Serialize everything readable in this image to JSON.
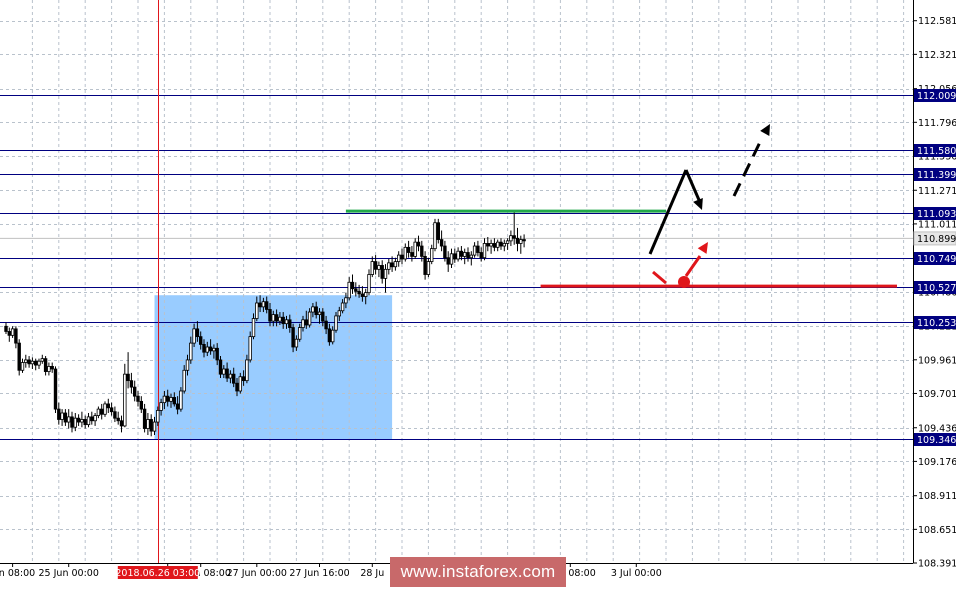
{
  "colors": {
    "background": "#ffffff",
    "grid": "#b9c2cc",
    "level_line": "#000080",
    "level_label_bg": "#000080",
    "level_label_text": "#ffffff",
    "current_price_bg": "#e6e6e6",
    "candle": "#000000",
    "zone": "#99ccff",
    "green_line": "#22a84a",
    "red_line": "#e0161b",
    "vertical_marker": "#e0161b",
    "date_marker_bg": "#e0161b"
  },
  "chart_data": {
    "type": "candlestick",
    "instrument": "USD/JPY",
    "ylim": [
      108.391,
      112.741
    ],
    "y_ticks": [
      "112.581",
      "112.321",
      "112.056",
      "111.796",
      "111.536",
      "111.271",
      "111.011",
      "110.751",
      "110.486",
      "110.221",
      "109.961",
      "109.701",
      "109.436",
      "109.176",
      "108.911",
      "108.651",
      "108.391"
    ],
    "x_ticks": [
      {
        "label": "Jun 08:00",
        "bar": 2
      },
      {
        "label": "25 Jun 00:00",
        "bar": 19
      },
      {
        "label": "26 Jun 16:00",
        "bar": 49
      },
      {
        "label": "27 Jun 08:00",
        "bar": 59
      },
      {
        "label": "27 Jun 00:00",
        "bar": 76
      },
      {
        "label": "27 Jun 16:00",
        "bar": 95
      },
      {
        "label": "28 Ju",
        "bar": 111
      },
      {
        "label": "2 Jul 08:00",
        "bar": 171
      },
      {
        "label": "3 Jul 00:00",
        "bar": 191
      }
    ],
    "time_marker": {
      "label": "2018.06.26 03:00",
      "bar": 46
    },
    "current_price": "110.899",
    "levels": [
      {
        "label": "112.009",
        "value": 112.009
      },
      {
        "label": "111.580",
        "value": 111.58
      },
      {
        "label": "111.399",
        "value": 111.399
      },
      {
        "label": "111.093",
        "value": 111.093
      },
      {
        "label": "110.749",
        "value": 110.749
      },
      {
        "label": "110.527",
        "value": 110.527
      },
      {
        "label": "110.253",
        "value": 110.253
      },
      {
        "label": "109.346",
        "value": 109.346
      }
    ],
    "zone": {
      "bar_from": 45,
      "bar_to": 117,
      "price_low": 109.346,
      "price_high": 110.46
    },
    "green_line": {
      "bar_from": 103,
      "bar_to": 200,
      "price": 111.11
    },
    "red_line": {
      "bar_from": 162,
      "bar_to": 270,
      "price": 110.53
    },
    "candles": [
      {
        "o": 110.22,
        "h": 110.25,
        "l": 110.16,
        "c": 110.18
      },
      {
        "o": 110.18,
        "h": 110.21,
        "l": 110.1,
        "c": 110.15
      },
      {
        "o": 110.15,
        "h": 110.22,
        "l": 110.13,
        "c": 110.2
      },
      {
        "o": 110.2,
        "h": 110.22,
        "l": 110.05,
        "c": 110.09
      },
      {
        "o": 110.09,
        "h": 110.12,
        "l": 109.84,
        "c": 109.88
      },
      {
        "o": 109.88,
        "h": 109.97,
        "l": 109.86,
        "c": 109.94
      },
      {
        "o": 109.94,
        "h": 110.0,
        "l": 109.9,
        "c": 109.96
      },
      {
        "o": 109.96,
        "h": 109.99,
        "l": 109.9,
        "c": 109.93
      },
      {
        "o": 109.93,
        "h": 109.98,
        "l": 109.89,
        "c": 109.95
      },
      {
        "o": 109.95,
        "h": 109.97,
        "l": 109.88,
        "c": 109.92
      },
      {
        "o": 109.92,
        "h": 109.97,
        "l": 109.89,
        "c": 109.95
      },
      {
        "o": 109.95,
        "h": 110.0,
        "l": 109.93,
        "c": 109.97
      },
      {
        "o": 109.97,
        "h": 109.99,
        "l": 109.84,
        "c": 109.87
      },
      {
        "o": 109.87,
        "h": 109.94,
        "l": 109.84,
        "c": 109.91
      },
      {
        "o": 109.91,
        "h": 109.94,
        "l": 109.86,
        "c": 109.89
      },
      {
        "o": 109.89,
        "h": 109.91,
        "l": 109.55,
        "c": 109.58
      },
      {
        "o": 109.58,
        "h": 109.63,
        "l": 109.46,
        "c": 109.5
      },
      {
        "o": 109.5,
        "h": 109.58,
        "l": 109.45,
        "c": 109.55
      },
      {
        "o": 109.55,
        "h": 109.58,
        "l": 109.45,
        "c": 109.48
      },
      {
        "o": 109.48,
        "h": 109.58,
        "l": 109.43,
        "c": 109.52
      },
      {
        "o": 109.52,
        "h": 109.56,
        "l": 109.4,
        "c": 109.44
      },
      {
        "o": 109.44,
        "h": 109.55,
        "l": 109.41,
        "c": 109.51
      },
      {
        "o": 109.51,
        "h": 109.54,
        "l": 109.45,
        "c": 109.48
      },
      {
        "o": 109.48,
        "h": 109.56,
        "l": 109.44,
        "c": 109.5
      },
      {
        "o": 109.5,
        "h": 109.53,
        "l": 109.43,
        "c": 109.46
      },
      {
        "o": 109.46,
        "h": 109.55,
        "l": 109.44,
        "c": 109.52
      },
      {
        "o": 109.52,
        "h": 109.56,
        "l": 109.46,
        "c": 109.49
      },
      {
        "o": 109.49,
        "h": 109.55,
        "l": 109.45,
        "c": 109.53
      },
      {
        "o": 109.53,
        "h": 109.6,
        "l": 109.51,
        "c": 109.58
      },
      {
        "o": 109.58,
        "h": 109.62,
        "l": 109.5,
        "c": 109.54
      },
      {
        "o": 109.54,
        "h": 109.64,
        "l": 109.52,
        "c": 109.62
      },
      {
        "o": 109.62,
        "h": 109.66,
        "l": 109.55,
        "c": 109.59
      },
      {
        "o": 109.59,
        "h": 109.63,
        "l": 109.53,
        "c": 109.56
      },
      {
        "o": 109.56,
        "h": 109.6,
        "l": 109.48,
        "c": 109.51
      },
      {
        "o": 109.51,
        "h": 109.56,
        "l": 109.46,
        "c": 109.49
      },
      {
        "o": 109.49,
        "h": 109.53,
        "l": 109.4,
        "c": 109.45
      },
      {
        "o": 109.45,
        "h": 109.93,
        "l": 109.44,
        "c": 109.85
      },
      {
        "o": 109.85,
        "h": 110.02,
        "l": 109.74,
        "c": 109.8
      },
      {
        "o": 109.8,
        "h": 109.86,
        "l": 109.7,
        "c": 109.75
      },
      {
        "o": 109.75,
        "h": 109.8,
        "l": 109.64,
        "c": 109.68
      },
      {
        "o": 109.68,
        "h": 109.72,
        "l": 109.6,
        "c": 109.64
      },
      {
        "o": 109.64,
        "h": 109.68,
        "l": 109.55,
        "c": 109.58
      },
      {
        "o": 109.58,
        "h": 109.62,
        "l": 109.4,
        "c": 109.43
      },
      {
        "o": 109.43,
        "h": 109.55,
        "l": 109.38,
        "c": 109.5
      },
      {
        "o": 109.5,
        "h": 109.54,
        "l": 109.37,
        "c": 109.41
      },
      {
        "o": 109.41,
        "h": 109.52,
        "l": 109.38,
        "c": 109.48
      },
      {
        "o": 109.48,
        "h": 109.6,
        "l": 109.45,
        "c": 109.57
      },
      {
        "o": 109.57,
        "h": 109.66,
        "l": 109.53,
        "c": 109.63
      },
      {
        "o": 109.63,
        "h": 109.72,
        "l": 109.58,
        "c": 109.68
      },
      {
        "o": 109.68,
        "h": 109.73,
        "l": 109.6,
        "c": 109.64
      },
      {
        "o": 109.64,
        "h": 109.7,
        "l": 109.59,
        "c": 109.67
      },
      {
        "o": 109.67,
        "h": 109.71,
        "l": 109.6,
        "c": 109.62
      },
      {
        "o": 109.62,
        "h": 109.68,
        "l": 109.54,
        "c": 109.58
      },
      {
        "o": 109.58,
        "h": 109.75,
        "l": 109.56,
        "c": 109.72
      },
      {
        "o": 109.72,
        "h": 109.92,
        "l": 109.7,
        "c": 109.88
      },
      {
        "o": 109.88,
        "h": 110.0,
        "l": 109.84,
        "c": 109.96
      },
      {
        "o": 109.96,
        "h": 110.14,
        "l": 109.93,
        "c": 110.09
      },
      {
        "o": 110.09,
        "h": 110.24,
        "l": 110.06,
        "c": 110.2
      },
      {
        "o": 110.2,
        "h": 110.26,
        "l": 110.1,
        "c": 110.14
      },
      {
        "o": 110.14,
        "h": 110.18,
        "l": 110.04,
        "c": 110.08
      },
      {
        "o": 110.08,
        "h": 110.12,
        "l": 109.98,
        "c": 110.02
      },
      {
        "o": 110.02,
        "h": 110.1,
        "l": 109.99,
        "c": 110.06
      },
      {
        "o": 110.06,
        "h": 110.12,
        "l": 110.0,
        "c": 110.03
      },
      {
        "o": 110.03,
        "h": 110.08,
        "l": 109.97,
        "c": 110.05
      },
      {
        "o": 110.05,
        "h": 110.09,
        "l": 109.92,
        "c": 109.96
      },
      {
        "o": 109.96,
        "h": 109.99,
        "l": 109.82,
        "c": 109.85
      },
      {
        "o": 109.85,
        "h": 109.92,
        "l": 109.82,
        "c": 109.89
      },
      {
        "o": 109.89,
        "h": 109.94,
        "l": 109.79,
        "c": 109.82
      },
      {
        "o": 109.82,
        "h": 109.88,
        "l": 109.78,
        "c": 109.85
      },
      {
        "o": 109.85,
        "h": 109.9,
        "l": 109.75,
        "c": 109.78
      },
      {
        "o": 109.78,
        "h": 109.82,
        "l": 109.68,
        "c": 109.72
      },
      {
        "o": 109.72,
        "h": 109.86,
        "l": 109.7,
        "c": 109.83
      },
      {
        "o": 109.83,
        "h": 109.88,
        "l": 109.76,
        "c": 109.8
      },
      {
        "o": 109.8,
        "h": 110.0,
        "l": 109.78,
        "c": 109.96
      },
      {
        "o": 109.96,
        "h": 110.18,
        "l": 109.94,
        "c": 110.14
      },
      {
        "o": 110.14,
        "h": 110.32,
        "l": 110.12,
        "c": 110.28
      },
      {
        "o": 110.28,
        "h": 110.45,
        "l": 110.26,
        "c": 110.4
      },
      {
        "o": 110.4,
        "h": 110.46,
        "l": 110.33,
        "c": 110.37
      },
      {
        "o": 110.37,
        "h": 110.44,
        "l": 110.33,
        "c": 110.41
      },
      {
        "o": 110.41,
        "h": 110.45,
        "l": 110.32,
        "c": 110.35
      },
      {
        "o": 110.35,
        "h": 110.4,
        "l": 110.22,
        "c": 110.26
      },
      {
        "o": 110.26,
        "h": 110.34,
        "l": 110.22,
        "c": 110.31
      },
      {
        "o": 110.31,
        "h": 110.35,
        "l": 110.22,
        "c": 110.26
      },
      {
        "o": 110.26,
        "h": 110.33,
        "l": 110.23,
        "c": 110.29
      },
      {
        "o": 110.29,
        "h": 110.33,
        "l": 110.2,
        "c": 110.24
      },
      {
        "o": 110.24,
        "h": 110.3,
        "l": 110.2,
        "c": 110.27
      },
      {
        "o": 110.27,
        "h": 110.31,
        "l": 110.17,
        "c": 110.21
      },
      {
        "o": 110.21,
        "h": 110.24,
        "l": 110.02,
        "c": 110.06
      },
      {
        "o": 110.06,
        "h": 110.15,
        "l": 110.03,
        "c": 110.12
      },
      {
        "o": 110.12,
        "h": 110.24,
        "l": 110.1,
        "c": 110.21
      },
      {
        "o": 110.21,
        "h": 110.3,
        "l": 110.18,
        "c": 110.27
      },
      {
        "o": 110.27,
        "h": 110.34,
        "l": 110.2,
        "c": 110.23
      },
      {
        "o": 110.23,
        "h": 110.36,
        "l": 110.21,
        "c": 110.33
      },
      {
        "o": 110.33,
        "h": 110.4,
        "l": 110.29,
        "c": 110.37
      },
      {
        "o": 110.37,
        "h": 110.41,
        "l": 110.28,
        "c": 110.31
      },
      {
        "o": 110.31,
        "h": 110.36,
        "l": 110.24,
        "c": 110.33
      },
      {
        "o": 110.33,
        "h": 110.36,
        "l": 110.22,
        "c": 110.26
      },
      {
        "o": 110.26,
        "h": 110.3,
        "l": 110.16,
        "c": 110.2
      },
      {
        "o": 110.2,
        "h": 110.24,
        "l": 110.07,
        "c": 110.1
      },
      {
        "o": 110.1,
        "h": 110.22,
        "l": 110.08,
        "c": 110.19
      },
      {
        "o": 110.19,
        "h": 110.33,
        "l": 110.17,
        "c": 110.3
      },
      {
        "o": 110.3,
        "h": 110.37,
        "l": 110.26,
        "c": 110.34
      },
      {
        "o": 110.34,
        "h": 110.43,
        "l": 110.32,
        "c": 110.4
      },
      {
        "o": 110.4,
        "h": 110.48,
        "l": 110.36,
        "c": 110.44
      },
      {
        "o": 110.44,
        "h": 110.6,
        "l": 110.42,
        "c": 110.56
      },
      {
        "o": 110.56,
        "h": 110.62,
        "l": 110.47,
        "c": 110.51
      },
      {
        "o": 110.51,
        "h": 110.56,
        "l": 110.45,
        "c": 110.49
      },
      {
        "o": 110.49,
        "h": 110.54,
        "l": 110.44,
        "c": 110.47
      },
      {
        "o": 110.47,
        "h": 110.53,
        "l": 110.41,
        "c": 110.45
      },
      {
        "o": 110.45,
        "h": 110.51,
        "l": 110.39,
        "c": 110.48
      },
      {
        "o": 110.48,
        "h": 110.66,
        "l": 110.46,
        "c": 110.62
      },
      {
        "o": 110.62,
        "h": 110.76,
        "l": 110.6,
        "c": 110.72
      },
      {
        "o": 110.72,
        "h": 110.77,
        "l": 110.62,
        "c": 110.66
      },
      {
        "o": 110.66,
        "h": 110.72,
        "l": 110.6,
        "c": 110.69
      },
      {
        "o": 110.69,
        "h": 110.73,
        "l": 110.55,
        "c": 110.59
      },
      {
        "o": 110.59,
        "h": 110.7,
        "l": 110.48,
        "c": 110.66
      },
      {
        "o": 110.66,
        "h": 110.74,
        "l": 110.62,
        "c": 110.71
      },
      {
        "o": 110.71,
        "h": 110.76,
        "l": 110.64,
        "c": 110.68
      },
      {
        "o": 110.68,
        "h": 110.75,
        "l": 110.65,
        "c": 110.72
      },
      {
        "o": 110.72,
        "h": 110.8,
        "l": 110.68,
        "c": 110.77
      },
      {
        "o": 110.77,
        "h": 110.82,
        "l": 110.7,
        "c": 110.74
      },
      {
        "o": 110.74,
        "h": 110.86,
        "l": 110.72,
        "c": 110.83
      },
      {
        "o": 110.83,
        "h": 110.88,
        "l": 110.75,
        "c": 110.79
      },
      {
        "o": 110.79,
        "h": 110.84,
        "l": 110.72,
        "c": 110.76
      },
      {
        "o": 110.76,
        "h": 110.9,
        "l": 110.74,
        "c": 110.87
      },
      {
        "o": 110.87,
        "h": 110.92,
        "l": 110.8,
        "c": 110.84
      },
      {
        "o": 110.84,
        "h": 110.88,
        "l": 110.72,
        "c": 110.76
      },
      {
        "o": 110.76,
        "h": 110.8,
        "l": 110.58,
        "c": 110.62
      },
      {
        "o": 110.62,
        "h": 110.75,
        "l": 110.6,
        "c": 110.72
      },
      {
        "o": 110.72,
        "h": 110.85,
        "l": 110.7,
        "c": 110.82
      },
      {
        "o": 110.82,
        "h": 111.05,
        "l": 110.8,
        "c": 111.02
      },
      {
        "o": 111.02,
        "h": 111.05,
        "l": 110.86,
        "c": 110.89
      },
      {
        "o": 110.89,
        "h": 110.96,
        "l": 110.8,
        "c": 110.84
      },
      {
        "o": 110.84,
        "h": 110.88,
        "l": 110.72,
        "c": 110.75
      },
      {
        "o": 110.75,
        "h": 110.8,
        "l": 110.64,
        "c": 110.7
      },
      {
        "o": 110.7,
        "h": 110.82,
        "l": 110.67,
        "c": 110.78
      },
      {
        "o": 110.78,
        "h": 110.82,
        "l": 110.71,
        "c": 110.74
      },
      {
        "o": 110.74,
        "h": 110.83,
        "l": 110.72,
        "c": 110.8
      },
      {
        "o": 110.8,
        "h": 110.84,
        "l": 110.73,
        "c": 110.76
      },
      {
        "o": 110.76,
        "h": 110.82,
        "l": 110.7,
        "c": 110.79
      },
      {
        "o": 110.79,
        "h": 110.83,
        "l": 110.72,
        "c": 110.75
      },
      {
        "o": 110.75,
        "h": 110.8,
        "l": 110.69,
        "c": 110.77
      },
      {
        "o": 110.77,
        "h": 110.87,
        "l": 110.75,
        "c": 110.84
      },
      {
        "o": 110.84,
        "h": 110.88,
        "l": 110.76,
        "c": 110.79
      },
      {
        "o": 110.79,
        "h": 110.83,
        "l": 110.72,
        "c": 110.75
      },
      {
        "o": 110.75,
        "h": 110.9,
        "l": 110.73,
        "c": 110.86
      },
      {
        "o": 110.86,
        "h": 110.91,
        "l": 110.8,
        "c": 110.84
      },
      {
        "o": 110.84,
        "h": 110.89,
        "l": 110.78,
        "c": 110.86
      },
      {
        "o": 110.86,
        "h": 110.9,
        "l": 110.8,
        "c": 110.83
      },
      {
        "o": 110.83,
        "h": 110.89,
        "l": 110.8,
        "c": 110.87
      },
      {
        "o": 110.87,
        "h": 110.9,
        "l": 110.81,
        "c": 110.84
      },
      {
        "o": 110.84,
        "h": 110.89,
        "l": 110.8,
        "c": 110.86
      },
      {
        "o": 110.86,
        "h": 110.9,
        "l": 110.81,
        "c": 110.88
      },
      {
        "o": 110.88,
        "h": 110.96,
        "l": 110.84,
        "c": 110.92
      },
      {
        "o": 110.92,
        "h": 111.1,
        "l": 110.85,
        "c": 110.9
      },
      {
        "o": 110.9,
        "h": 110.98,
        "l": 110.8,
        "c": 110.86
      },
      {
        "o": 110.86,
        "h": 110.92,
        "l": 110.78,
        "c": 110.89
      },
      {
        "o": 110.89,
        "h": 110.93,
        "l": 110.83,
        "c": 110.88
      }
    ]
  }
}
